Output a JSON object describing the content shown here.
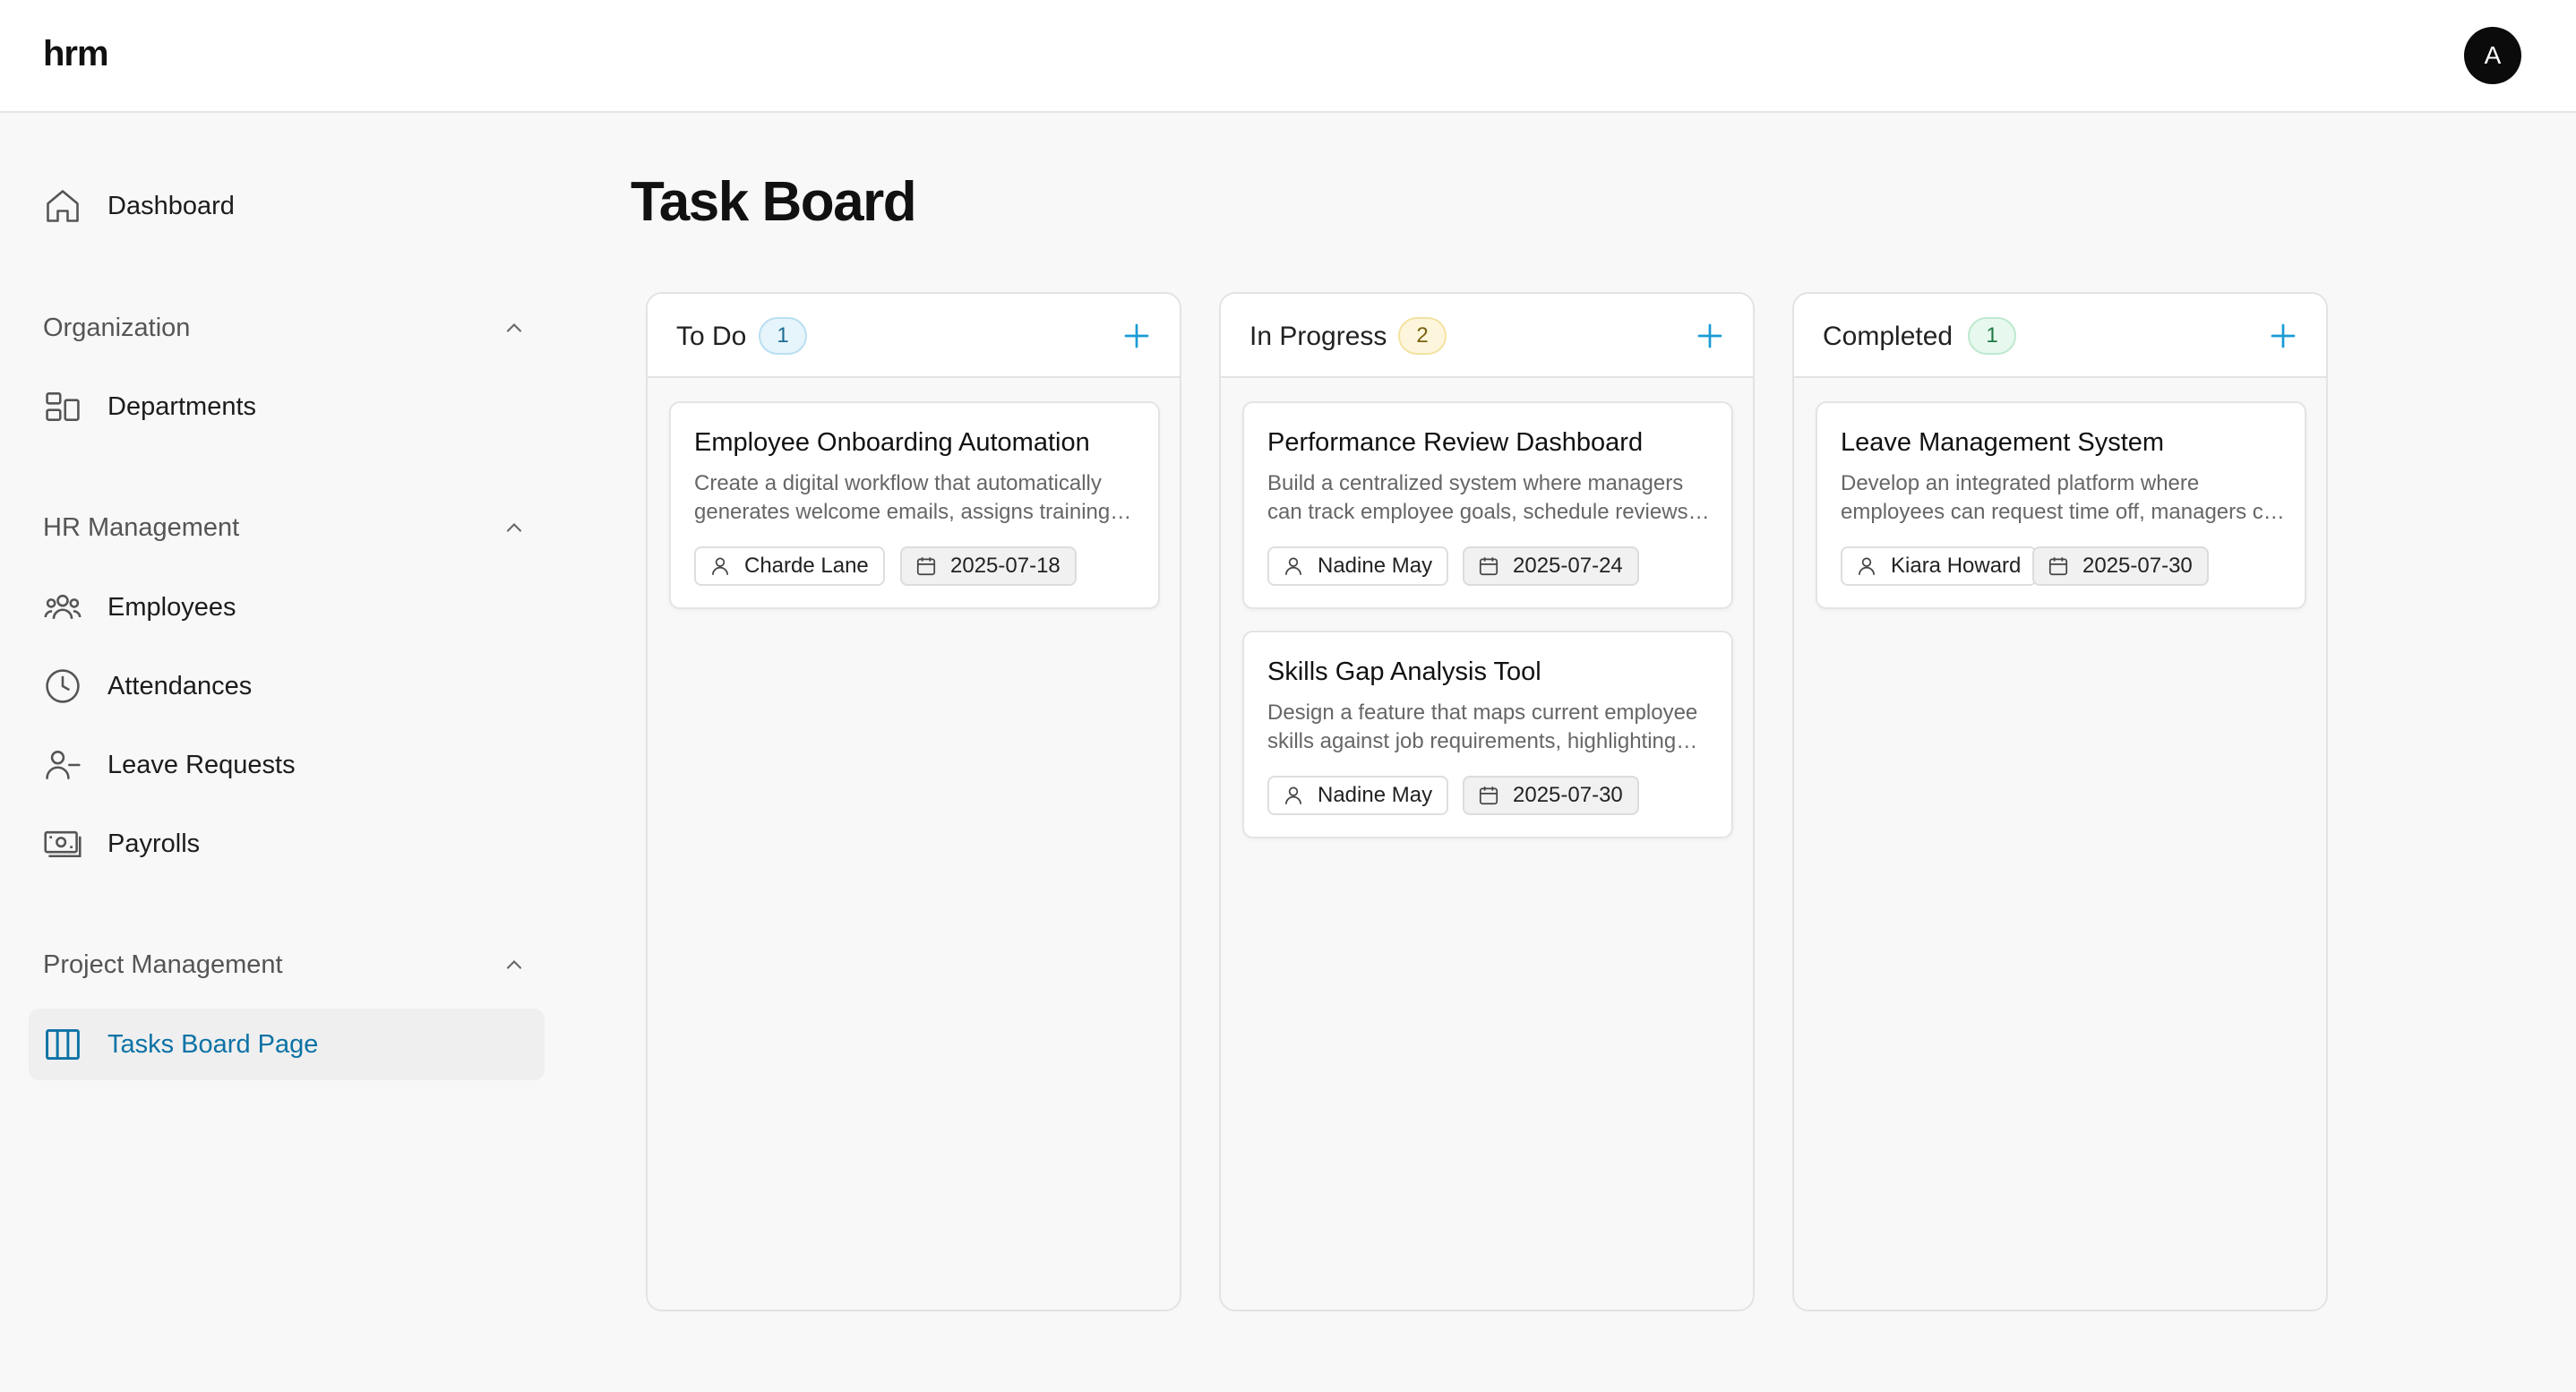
{
  "app": {
    "logo": "hrm",
    "avatar_initial": "A"
  },
  "sidebar": {
    "dashboard": {
      "label": "Dashboard",
      "icon": "home-icon"
    },
    "sections": [
      {
        "label": "Organization",
        "items": [
          {
            "label": "Departments",
            "icon": "departments-icon"
          }
        ]
      },
      {
        "label": "HR Management",
        "items": [
          {
            "label": "Employees",
            "icon": "users-icon"
          },
          {
            "label": "Attendances",
            "icon": "clock-icon"
          },
          {
            "label": "Leave Requests",
            "icon": "user-minus-icon"
          },
          {
            "label": "Payrolls",
            "icon": "banknote-icon"
          }
        ]
      },
      {
        "label": "Project Management",
        "items": [
          {
            "label": "Tasks Board Page",
            "icon": "columns-icon",
            "active": true
          }
        ]
      }
    ]
  },
  "main": {
    "title": "Task Board",
    "columns": [
      {
        "title": "To Do",
        "count": "1",
        "badge_color": "#1b6c93",
        "cards": [
          {
            "title": "Employee Onboarding Automation",
            "description": "Create a digital workflow that automatically generates welcome emails, assigns training modules and schedules orientation meetings",
            "assignee": "Charde Lane",
            "due": "2025-07-18"
          }
        ]
      },
      {
        "title": "In Progress",
        "count": "2",
        "badge_color": "#7a6210",
        "cards": [
          {
            "title": "Performance Review Dashboard",
            "description": "Build a centralized system where managers can track employee goals, schedule reviews and record feedback",
            "assignee": "Nadine May",
            "due": "2025-07-24"
          },
          {
            "title": "Skills Gap Analysis Tool",
            "description": "Design a feature that maps current employee skills against job requirements, highlighting training needs",
            "assignee": "Nadine May",
            "due": "2025-07-30"
          }
        ]
      },
      {
        "title": "Completed",
        "count": "1",
        "badge_color": "#1f7a45",
        "cards": [
          {
            "title": "Leave Management System",
            "description": "Develop an integrated platform where employees can request time off, managers can approve requests",
            "assignee": "Kiara Howard",
            "due": "2025-07-30"
          }
        ]
      }
    ]
  },
  "colors": {
    "accent": "#0b72a6",
    "plus_icon": "#1a9bd6",
    "background": "#f8f8f8"
  }
}
